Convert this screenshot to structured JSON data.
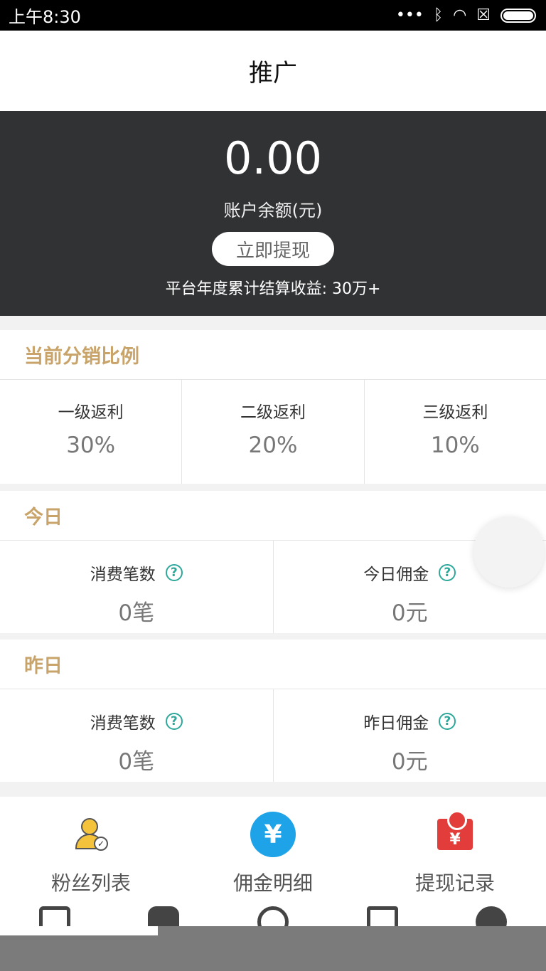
{
  "status_bar": {
    "time": "上午8:30",
    "icons": [
      "dots-icon",
      "bluetooth-icon",
      "wifi-icon",
      "sim-x-icon",
      "battery-icon"
    ]
  },
  "header": {
    "title": "推广"
  },
  "balance": {
    "amount": "0.00",
    "label": "账户余额(元)",
    "withdraw_label": "立即提现",
    "platform_text": "平台年度累计结算收益: 30万+"
  },
  "distribution": {
    "title": "当前分销比例",
    "items": [
      {
        "label": "一级返利",
        "value": "30%"
      },
      {
        "label": "二级返利",
        "value": "20%"
      },
      {
        "label": "三级返利",
        "value": "10%"
      }
    ]
  },
  "today": {
    "title": "今日",
    "items": [
      {
        "label": "消费笔数",
        "value": "0笔"
      },
      {
        "label": "今日佣金",
        "value": "0元"
      }
    ]
  },
  "yesterday": {
    "title": "昨日",
    "items": [
      {
        "label": "消费笔数",
        "value": "0笔"
      },
      {
        "label": "昨日佣金",
        "value": "0元"
      }
    ]
  },
  "actions": [
    {
      "label": "粉丝列表",
      "icon": "fans-list-icon"
    },
    {
      "label": "佣金明细",
      "icon": "yen-icon",
      "glyph": "¥"
    },
    {
      "label": "提现记录",
      "icon": "withdraw-record-icon",
      "glyph": "¥"
    }
  ],
  "help_glyph": "?",
  "colors": {
    "accent": "#c8a46a",
    "panel": "#313234",
    "help": "#2ea89b",
    "yen": "#1ea3e8",
    "red": "#e23d3a"
  }
}
